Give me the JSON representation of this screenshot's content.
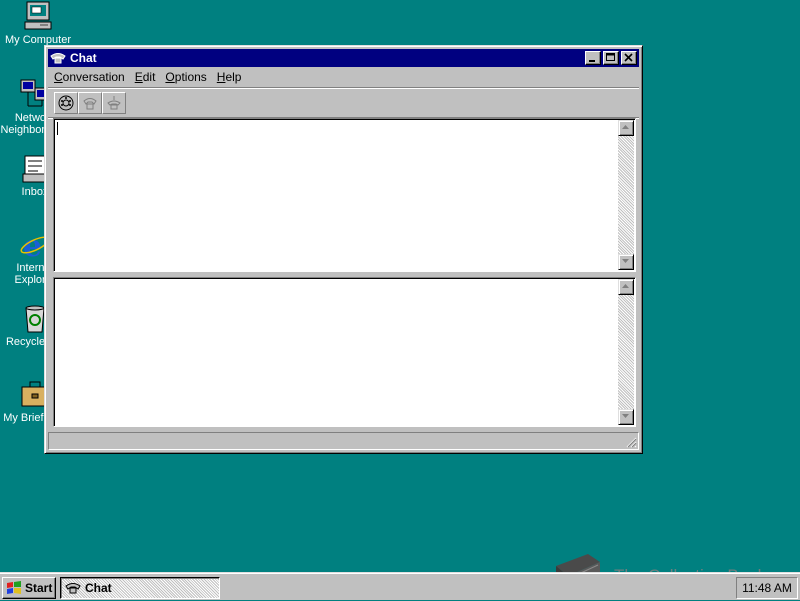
{
  "desktop": {
    "background": "#008080",
    "icons": [
      {
        "label": "My Computer",
        "icon": "my-computer-icon"
      },
      {
        "label": "Network Neighborhood",
        "icon": "network-neighborhood-icon"
      },
      {
        "label": "Inbox",
        "icon": "inbox-icon"
      },
      {
        "label": "Internet Explorer",
        "icon": "internet-explorer-icon"
      },
      {
        "label": "Recycle Bin",
        "icon": "recycle-bin-icon"
      },
      {
        "label": "My Briefcase",
        "icon": "briefcase-icon"
      }
    ]
  },
  "window": {
    "title": "Chat",
    "title_bar_color": "#000080",
    "menu": [
      {
        "label": "Conversation",
        "accel": "C"
      },
      {
        "label": "Edit",
        "accel": "E"
      },
      {
        "label": "Options",
        "accel": "O"
      },
      {
        "label": "Help",
        "accel": "H"
      }
    ],
    "toolbar": [
      {
        "icon": "dial-icon",
        "enabled": true
      },
      {
        "icon": "answer-icon",
        "enabled": false
      },
      {
        "icon": "hang-up-icon",
        "enabled": false
      }
    ],
    "top_pane_text": "",
    "bottom_pane_text": "",
    "status_text": ""
  },
  "taskbar": {
    "start_label": "Start",
    "tasks": [
      {
        "label": "Chat",
        "icon": "chat-icon",
        "active": true
      }
    ],
    "clock": "11:48 AM"
  },
  "watermark": {
    "text": "The Collection Book",
    "icon": "book-icon"
  }
}
